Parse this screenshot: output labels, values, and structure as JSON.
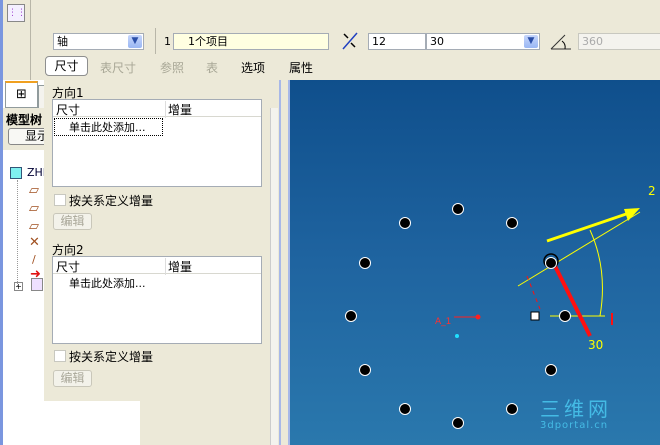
{
  "toolbar": {
    "type_select": "轴",
    "count_label": "1",
    "items_field": "1个项目",
    "count_value": "12",
    "increment_value": "30",
    "angle_value": "360"
  },
  "tabs": [
    {
      "label": "尺寸"
    },
    {
      "label": "表尺寸"
    },
    {
      "label": "参照"
    },
    {
      "label": "表"
    },
    {
      "label": "选项"
    },
    {
      "label": "属性"
    }
  ],
  "tree": {
    "title": "模型树",
    "show_button": "显示",
    "root": "ZHE"
  },
  "direction1": {
    "title": "方向1",
    "col_dim": "尺寸",
    "col_inc": "增量",
    "add_row": "单击此处添加...",
    "checkbox": "按关系定义增量",
    "edit": "编辑"
  },
  "direction2": {
    "title": "方向2",
    "col_dim": "尺寸",
    "col_inc": "增量",
    "add_row": "单击此处添加...",
    "checkbox": "按关系定义增量",
    "edit": "编辑"
  },
  "graphics": {
    "count_label": "2",
    "angle_label": "30",
    "axis_label": "A_1",
    "watermark": "三维网",
    "watermark_sub": "3dportal.cn",
    "bg": "#1d5c94",
    "accent": "#ffff00"
  }
}
